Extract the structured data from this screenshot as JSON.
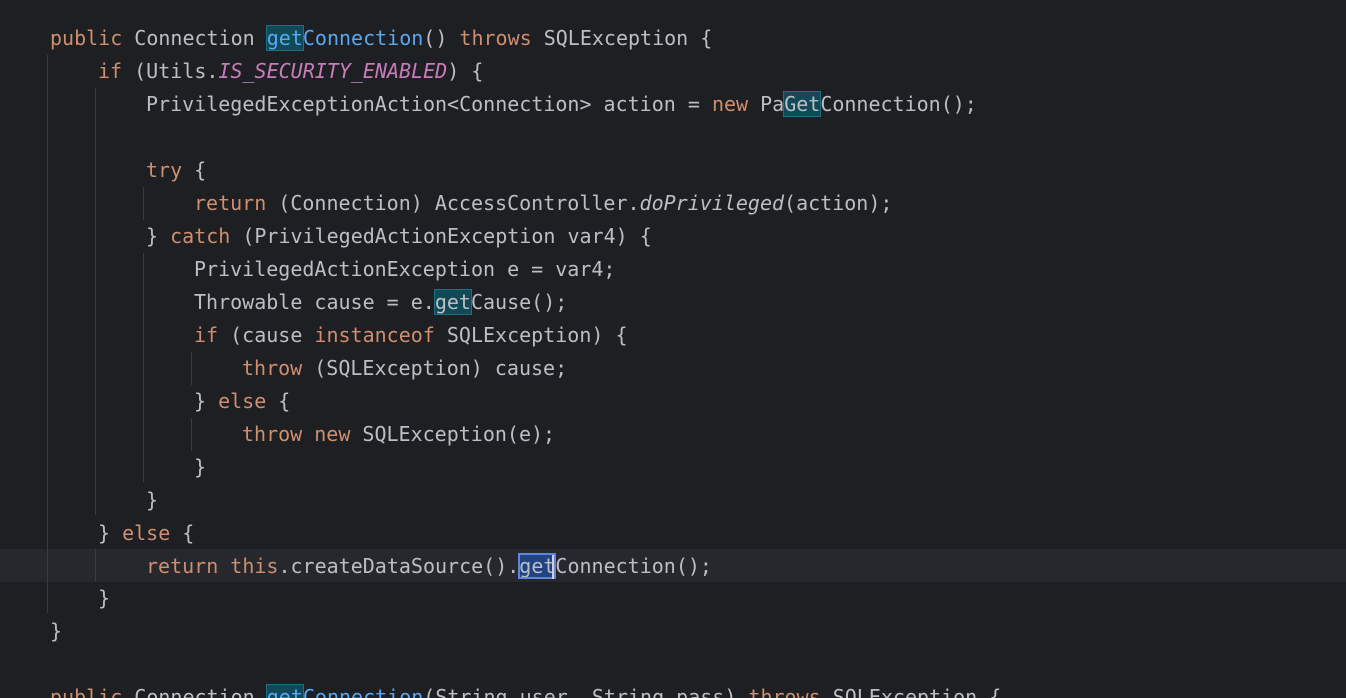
{
  "editor": {
    "lines": [
      {
        "tokens": [
          {
            "t": "public",
            "c": "kw"
          },
          {
            "t": " Connection ",
            "c": ""
          },
          {
            "t": "get",
            "c": "fn hl"
          },
          {
            "t": "Connection",
            "c": "fn"
          },
          {
            "t": "() ",
            "c": ""
          },
          {
            "t": "throws",
            "c": "kw"
          },
          {
            "t": " SQLException {",
            "c": ""
          }
        ]
      },
      {
        "tokens": [
          {
            "t": "if",
            "c": "kw"
          },
          {
            "t": " (Utils.",
            "c": ""
          },
          {
            "t": "IS_SECURITY_ENABLED",
            "c": "field"
          },
          {
            "t": ") {",
            "c": ""
          }
        ]
      },
      {
        "tokens": [
          {
            "t": "PrivilegedExceptionAction<Connection> action = ",
            "c": ""
          },
          {
            "t": "new",
            "c": "kw"
          },
          {
            "t": " Pa",
            "c": ""
          },
          {
            "t": "Get",
            "c": "hl"
          },
          {
            "t": "Connection();",
            "c": ""
          }
        ]
      },
      {
        "tokens": []
      },
      {
        "tokens": [
          {
            "t": "try",
            "c": "kw"
          },
          {
            "t": " {",
            "c": ""
          }
        ]
      },
      {
        "tokens": [
          {
            "t": "return",
            "c": "kw"
          },
          {
            "t": " (Connection) AccessController.",
            "c": ""
          },
          {
            "t": "doPrivileged",
            "c": "ital"
          },
          {
            "t": "(action);",
            "c": ""
          }
        ]
      },
      {
        "tokens": [
          {
            "t": "} ",
            "c": ""
          },
          {
            "t": "catch",
            "c": "kw"
          },
          {
            "t": " (PrivilegedActionException var4) {",
            "c": ""
          }
        ]
      },
      {
        "tokens": [
          {
            "t": "PrivilegedActionException e = var4;",
            "c": ""
          }
        ]
      },
      {
        "tokens": [
          {
            "t": "Throwable cause = e.",
            "c": ""
          },
          {
            "t": "get",
            "c": "hl"
          },
          {
            "t": "Cause();",
            "c": ""
          }
        ]
      },
      {
        "tokens": [
          {
            "t": "if",
            "c": "kw"
          },
          {
            "t": " (cause ",
            "c": ""
          },
          {
            "t": "instanceof",
            "c": "kw"
          },
          {
            "t": " SQLException) {",
            "c": ""
          }
        ]
      },
      {
        "tokens": [
          {
            "t": "throw",
            "c": "kw"
          },
          {
            "t": " (SQLException) cause;",
            "c": ""
          }
        ]
      },
      {
        "tokens": [
          {
            "t": "} ",
            "c": ""
          },
          {
            "t": "else",
            "c": "kw"
          },
          {
            "t": " {",
            "c": ""
          }
        ]
      },
      {
        "tokens": [
          {
            "t": "throw",
            "c": "kw"
          },
          {
            "t": " ",
            "c": ""
          },
          {
            "t": "new",
            "c": "kw"
          },
          {
            "t": " SQLException(e);",
            "c": ""
          }
        ]
      },
      {
        "tokens": [
          {
            "t": "}",
            "c": ""
          }
        ]
      },
      {
        "tokens": [
          {
            "t": "}",
            "c": ""
          }
        ]
      },
      {
        "tokens": [
          {
            "t": "} ",
            "c": ""
          },
          {
            "t": "else",
            "c": "kw"
          },
          {
            "t": " {",
            "c": ""
          }
        ]
      },
      {
        "tokens": [
          {
            "t": "return",
            "c": "kw"
          },
          {
            "t": " ",
            "c": ""
          },
          {
            "t": "this",
            "c": "kw"
          },
          {
            "t": ".createDataSource().",
            "c": ""
          },
          {
            "t": "get",
            "c": "hl-sel"
          },
          {
            "t": "Connection();",
            "c": ""
          }
        ]
      },
      {
        "tokens": [
          {
            "t": "}",
            "c": ""
          }
        ]
      },
      {
        "tokens": [
          {
            "t": "}",
            "c": ""
          }
        ]
      },
      {
        "tokens": []
      },
      {
        "tokens": [
          {
            "t": "public",
            "c": "kw"
          },
          {
            "t": " Connection ",
            "c": ""
          },
          {
            "t": "get",
            "c": "fn hl"
          },
          {
            "t": "Connection",
            "c": "fn"
          },
          {
            "t": "(String user, String pass) ",
            "c": ""
          },
          {
            "t": "throws",
            "c": "kw"
          },
          {
            "t": " SQLException {",
            "c": ""
          }
        ]
      }
    ]
  }
}
